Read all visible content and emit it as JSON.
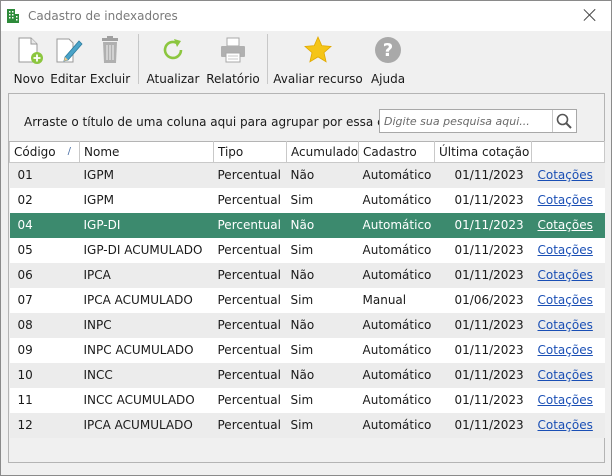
{
  "window": {
    "title": "Cadastro de indexadores"
  },
  "toolbar": {
    "novo": "Novo",
    "editar": "Editar",
    "excluir": "Excluir",
    "atualizar": "Atualizar",
    "relatorio": "Relatório",
    "avaliar": "Avaliar recurso",
    "ajuda": "Ajuda"
  },
  "groupbar": {
    "hint": "Arraste o título de uma coluna aqui para agrupar por essa coluna",
    "search_placeholder": "Digite sua pesquisa aqui..."
  },
  "grid": {
    "columns": [
      "Código",
      "Nome",
      "Tipo",
      "Acumulado",
      "Cadastro",
      "Última cotação",
      ""
    ],
    "rows": [
      {
        "codigo": "01",
        "nome": "IGPM",
        "tipo": "Percentual",
        "acumulado": "Não",
        "cadastro": "Automático",
        "ultima": "01/11/2023",
        "link": "Cotações"
      },
      {
        "codigo": "02",
        "nome": "IGPM",
        "tipo": "Percentual",
        "acumulado": "Sim",
        "cadastro": "Automático",
        "ultima": "01/11/2023",
        "link": "Cotações"
      },
      {
        "codigo": "04",
        "nome": "IGP-DI",
        "tipo": "Percentual",
        "acumulado": "Não",
        "cadastro": "Automático",
        "ultima": "01/11/2023",
        "link": "Cotações"
      },
      {
        "codigo": "05",
        "nome": "IGP-DI ACUMULADO",
        "tipo": "Percentual",
        "acumulado": "Sim",
        "cadastro": "Automático",
        "ultima": "01/11/2023",
        "link": "Cotações"
      },
      {
        "codigo": "06",
        "nome": "IPCA",
        "tipo": "Percentual",
        "acumulado": "Não",
        "cadastro": "Automático",
        "ultima": "01/11/2023",
        "link": "Cotações"
      },
      {
        "codigo": "07",
        "nome": "IPCA ACUMULADO",
        "tipo": "Percentual",
        "acumulado": "Sim",
        "cadastro": "Manual",
        "ultima": "01/06/2023",
        "link": "Cotações"
      },
      {
        "codigo": "08",
        "nome": "INPC",
        "tipo": "Percentual",
        "acumulado": "Não",
        "cadastro": "Automático",
        "ultima": "01/11/2023",
        "link": "Cotações"
      },
      {
        "codigo": "09",
        "nome": "INPC ACUMULADO",
        "tipo": "Percentual",
        "acumulado": "Sim",
        "cadastro": "Automático",
        "ultima": "01/11/2023",
        "link": "Cotações"
      },
      {
        "codigo": "10",
        "nome": "INCC",
        "tipo": "Percentual",
        "acumulado": "Não",
        "cadastro": "Automático",
        "ultima": "01/11/2023",
        "link": "Cotações"
      },
      {
        "codigo": "11",
        "nome": "INCC ACUMULADO",
        "tipo": "Percentual",
        "acumulado": "Sim",
        "cadastro": "Automático",
        "ultima": "01/11/2023",
        "link": "Cotações"
      },
      {
        "codigo": "12",
        "nome": "IPCA ACUMULADO",
        "tipo": "Percentual",
        "acumulado": "Sim",
        "cadastro": "Automático",
        "ultima": "01/11/2023",
        "link": "Cotações"
      }
    ],
    "selected_row": 2,
    "sort_column": "Código",
    "sort_direction": "ascending"
  },
  "colors": {
    "selected_row": "#3c8a6e",
    "link": "#1a4fb5",
    "app_icon": "#2e8b3a"
  },
  "icons": {
    "app": "building-icon",
    "novo": "new-document-icon",
    "editar": "edit-pencil-icon",
    "excluir": "trash-icon",
    "atualizar": "refresh-icon",
    "relatorio": "printer-icon",
    "avaliar": "star-icon",
    "ajuda": "help-icon",
    "search": "search-icon"
  }
}
